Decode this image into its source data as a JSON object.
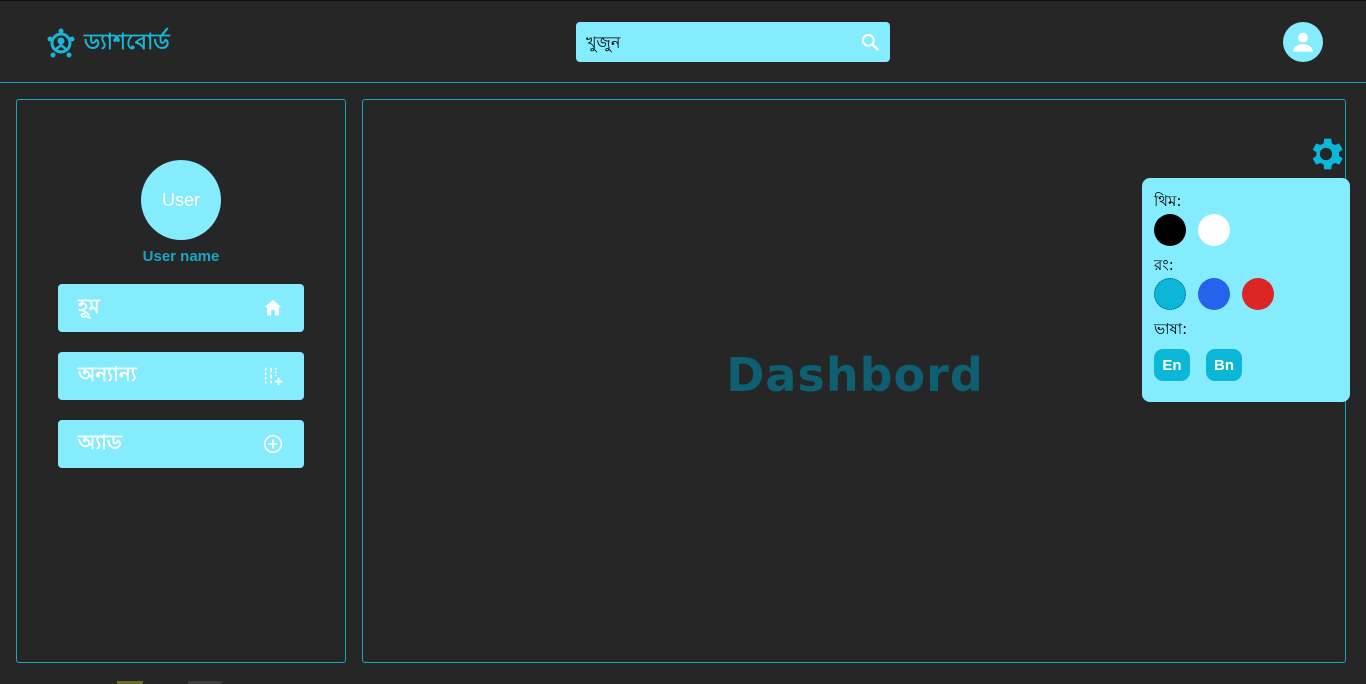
{
  "header": {
    "brand": "ড্যাশবোর্ড",
    "search_placeholder": "খুজুন"
  },
  "sidebar": {
    "avatar_text": "User",
    "user_name": "User name",
    "items": [
      {
        "label": "হূম",
        "icon": "home-icon"
      },
      {
        "label": "অন্যান্য",
        "icon": "tune-add-icon"
      },
      {
        "label": "অ্যাড",
        "icon": "add-circle-icon"
      }
    ]
  },
  "main": {
    "title": "Dashbord"
  },
  "settings": {
    "theme_label": "থিম:",
    "color_label": "রং:",
    "language_label": "ভাষা:",
    "themes": [
      "#000000",
      "#ffffff"
    ],
    "colors": [
      "#0bb6d6",
      "#2563eb",
      "#dc2626"
    ],
    "languages": [
      "En",
      "Bn"
    ]
  },
  "colors": {
    "accent": "#84ecfd",
    "accent_dark": "#19b6d6",
    "background": "#262626"
  }
}
